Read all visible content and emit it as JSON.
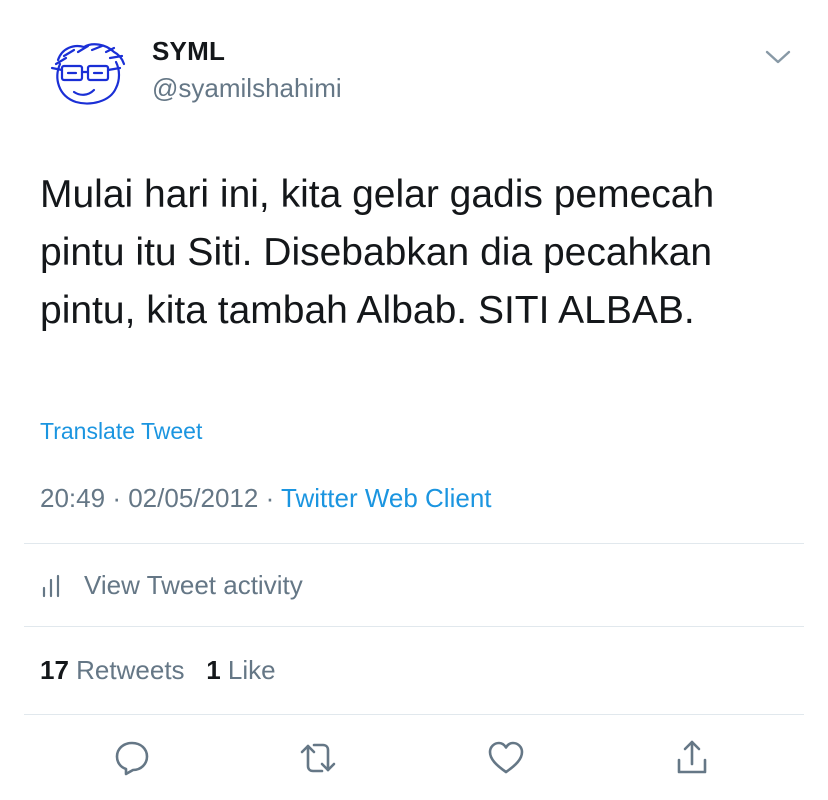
{
  "user": {
    "display_name": "SYML",
    "handle": "@syamilshahimi",
    "avatar_icon": "doodle-avatar-icon"
  },
  "tweet": {
    "lines": [
      "Mulai hari ini, kita gelar gadis pemecah",
      "pintu itu Siti. Disebabkan dia pecahkan",
      "pintu, kita tambah Albab. SITI ALBAB."
    ],
    "translate_label": "Translate Tweet",
    "time": "20:49",
    "date": "02/05/2012",
    "separator": "·",
    "source": "Twitter Web Client"
  },
  "activity": {
    "label": "View Tweet activity",
    "icon": "bar-chart-icon"
  },
  "stats": {
    "retweets_count": "17",
    "retweets_label": "Retweets",
    "likes_count": "1",
    "likes_label": "Like"
  },
  "actions": {
    "reply_icon": "reply-icon",
    "retweet_icon": "retweet-icon",
    "like_icon": "heart-icon",
    "share_icon": "share-icon"
  },
  "colors": {
    "link": "#1b95e0",
    "secondary_text": "#657786",
    "primary_text": "#14171a",
    "divider": "#e1e8ed",
    "avatar_stroke": "#1a2fd6"
  }
}
